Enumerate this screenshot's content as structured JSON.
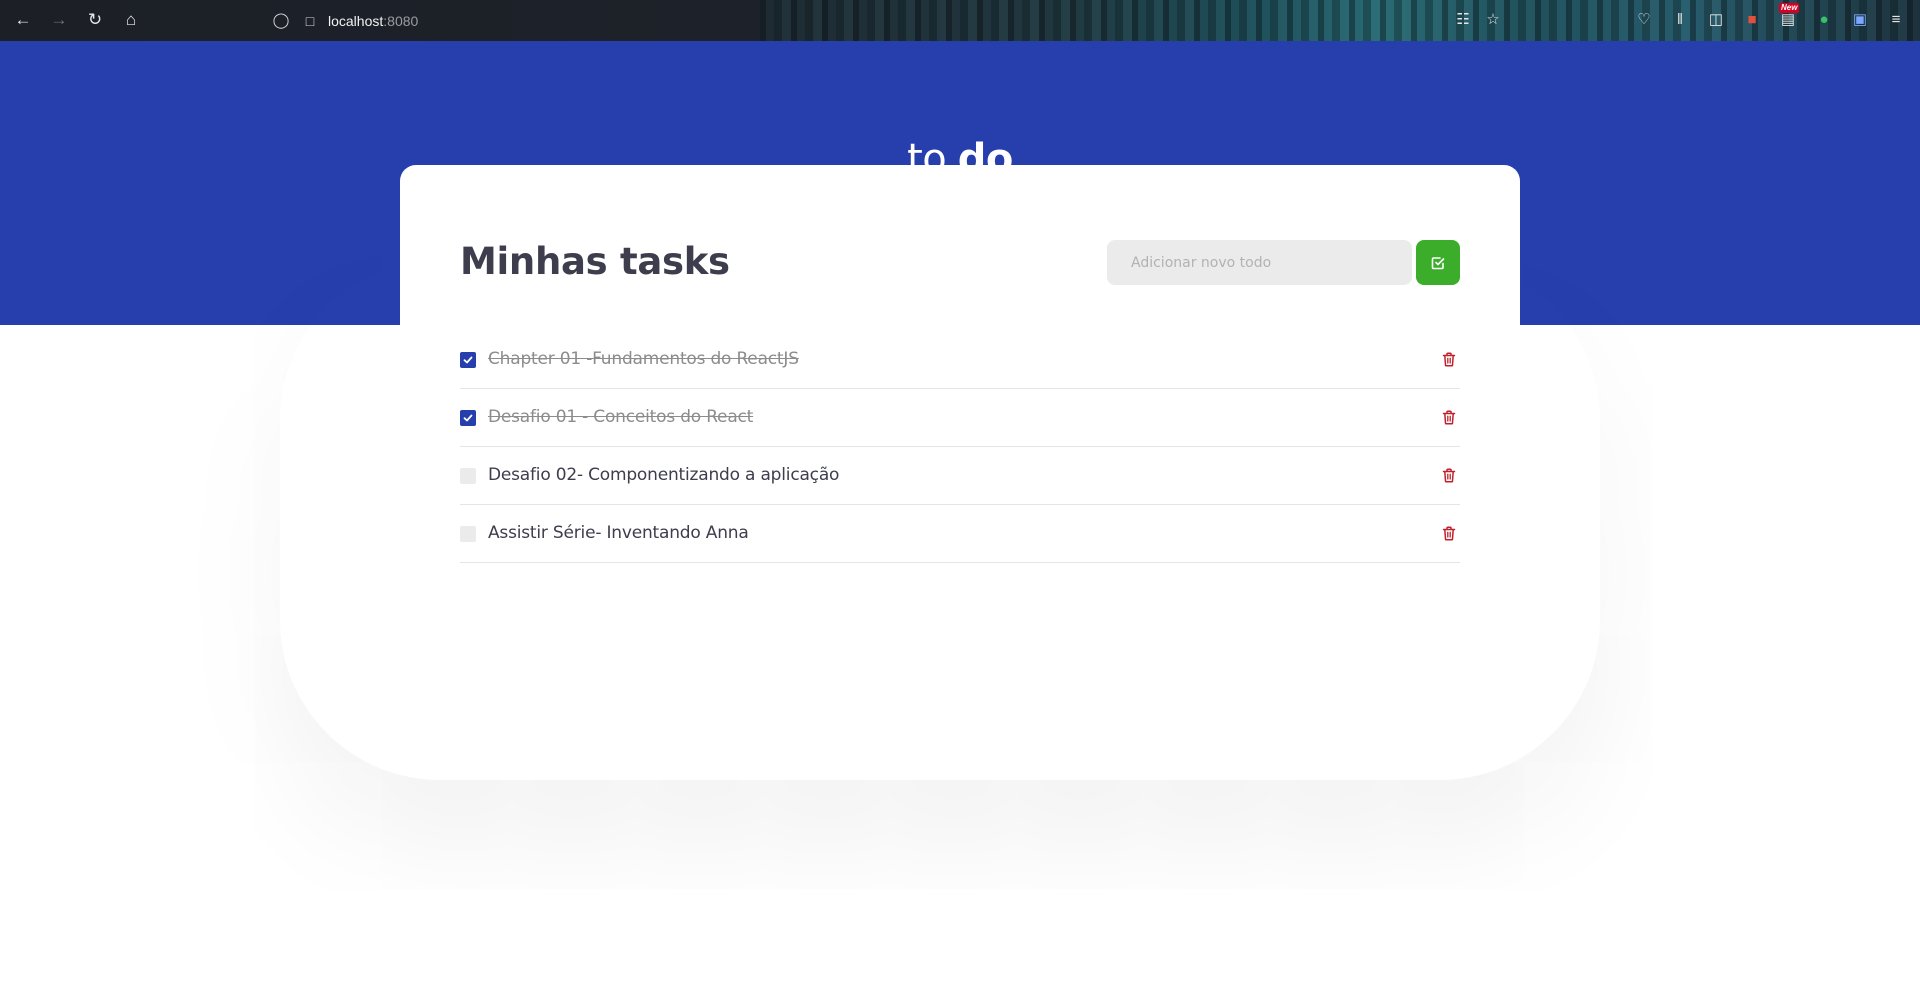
{
  "browser": {
    "url_host": "localhost",
    "url_port": ":8080",
    "new_badge": "New",
    "icons": [
      "back-icon",
      "forward-icon",
      "reload-icon",
      "home-icon",
      "shield-icon",
      "page-icon",
      "translate-icon",
      "bookmark-star-icon",
      "pocket-icon",
      "library-icon",
      "sidebar-icon",
      "extension-icon",
      "news-extension-icon",
      "vpn-extension-icon",
      "translator-extension-icon",
      "menu-icon"
    ]
  },
  "header": {
    "logo_light": "to.",
    "logo_bold": "do",
    "background": "#273fad"
  },
  "card": {
    "title": "Minhas tasks",
    "input_placeholder": "Adicionar novo todo",
    "input_value": "",
    "add_button_color": "#3bad2a"
  },
  "tasks": [
    {
      "title": "Chapter 01 -Fundamentos do ReactJS",
      "completed": true
    },
    {
      "title": "Desafio 01 - Conceitos do React",
      "completed": true
    },
    {
      "title": "Desafio 02- Componentizando a aplicação",
      "completed": false
    },
    {
      "title": "Assistir Série- Inventando Anna",
      "completed": false
    }
  ],
  "colors": {
    "accent": "#273fad",
    "trash": "#c0202a",
    "text": "#3d3d4d"
  }
}
